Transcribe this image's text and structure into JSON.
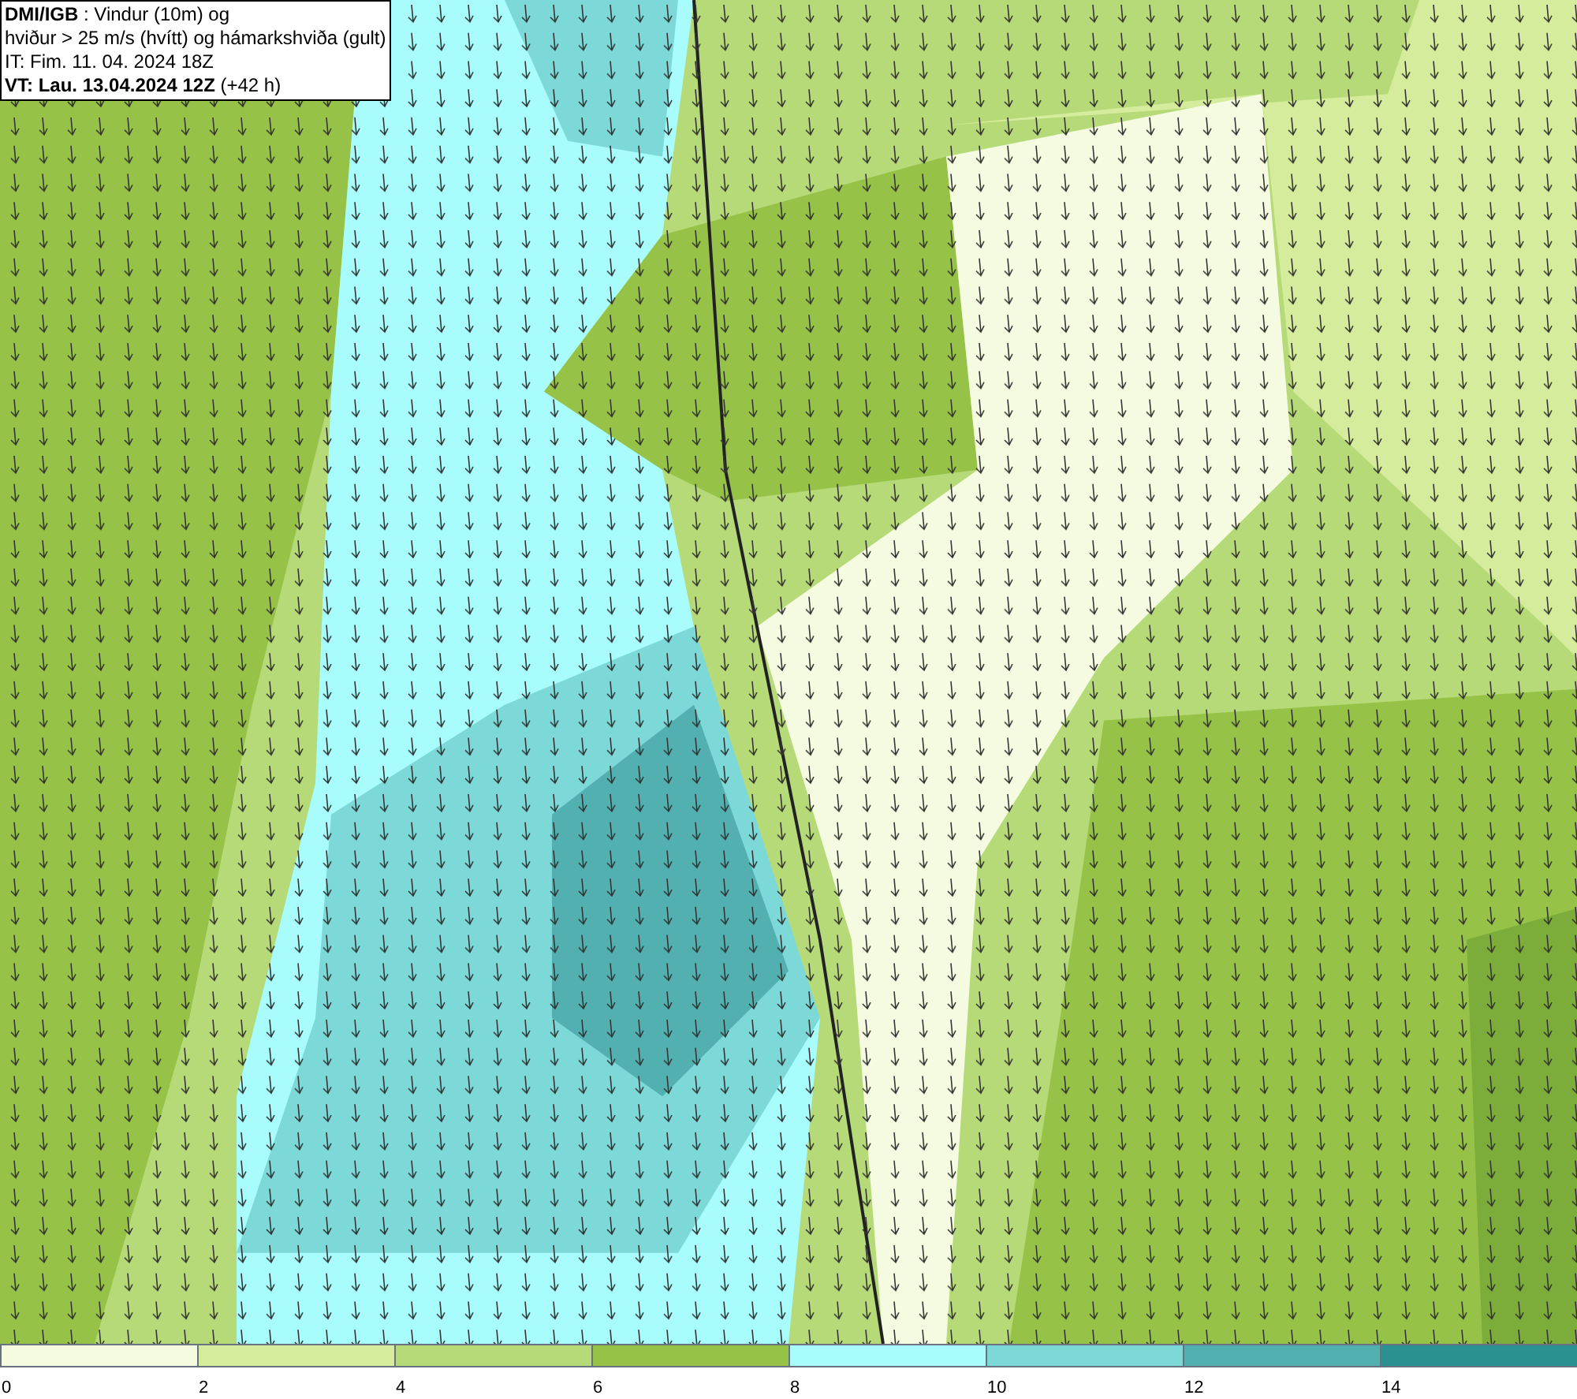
{
  "header": {
    "lines": [
      "**DMI/IGB** : Vindur (10m) og",
      "hviður > 25 m/s (hvítt) og hámarkshviða (gult)",
      "IT: Fim. 11. 04. 2024 18Z",
      "**VT: Lau. 13.04.2024 12Z** (+42 h)"
    ]
  },
  "legend": {
    "bins": [
      {
        "color": "#f5fbe0"
      },
      {
        "color": "#d4ec9c"
      },
      {
        "color": "#b6da78"
      },
      {
        "color": "#96c247"
      },
      {
        "color": "#a8fcfc"
      },
      {
        "color": "#7dd8d8"
      },
      {
        "color": "#52b0b0"
      },
      {
        "color": "#2a9090"
      }
    ],
    "ticks": [
      "0",
      "2",
      "4",
      "6",
      "8",
      "10",
      "12",
      "14"
    ]
  }
}
